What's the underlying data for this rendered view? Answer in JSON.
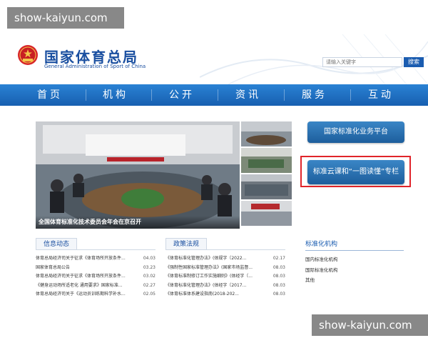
{
  "watermark": {
    "top": "show-kaiyun.com",
    "bottom": "show-kaiyun.com"
  },
  "site": {
    "title_cn": "国家体育总局",
    "title_en": "General Administration of Sport of China"
  },
  "search": {
    "placeholder": "请输入关键字",
    "button_label": "搜索"
  },
  "nav": {
    "items": [
      "首页",
      "机构",
      "公开",
      "资讯",
      "服务",
      "互动"
    ]
  },
  "carousel": {
    "caption": "全国体育标准化技术委员会年会在京召开"
  },
  "side_buttons": {
    "platform": "国家标准化业务平台",
    "column": "标准云课和“一图读懂”专栏"
  },
  "news": {
    "title": "信息动态",
    "items": [
      {
        "text": "体育总局经济司关于征求《体育场所开放条件...",
        "date": "04.03"
      },
      {
        "text": "国家体育总局公告",
        "date": "03.23"
      },
      {
        "text": "体育总局经济司关于征求《体育场所开放条件...",
        "date": "03.02"
      },
      {
        "text": "《健身运动场所适老化 通用要求》国家标准...",
        "date": "02.27"
      },
      {
        "text": "体育总局经济司关于《运动员训练期科学补水...",
        "date": "02.05"
      }
    ]
  },
  "policy": {
    "title": "政策法规",
    "items": [
      {
        "text": "《体育标准化管理办法》(体规字〔2022...",
        "date": "02.17"
      },
      {
        "text": "《强制性国家标准管理办法》(国家市场监督...",
        "date": "08.03"
      },
      {
        "text": "《体育标准制修订工作实施细则》(体经字〔...",
        "date": "08.03"
      },
      {
        "text": "《体育标准化管理办法》(体经字〔2017...",
        "date": "08.03"
      },
      {
        "text": "《体育标准体系建设指南(2018-202...",
        "date": "08.03"
      }
    ]
  },
  "standard_org": {
    "title": "标准化机构",
    "items": [
      "国内标准化机构",
      "国际标准化机构",
      "其他"
    ]
  },
  "colors": {
    "nav": "#1f6fc4",
    "brand": "#1a4fa0",
    "highlight": "#e0242a"
  }
}
